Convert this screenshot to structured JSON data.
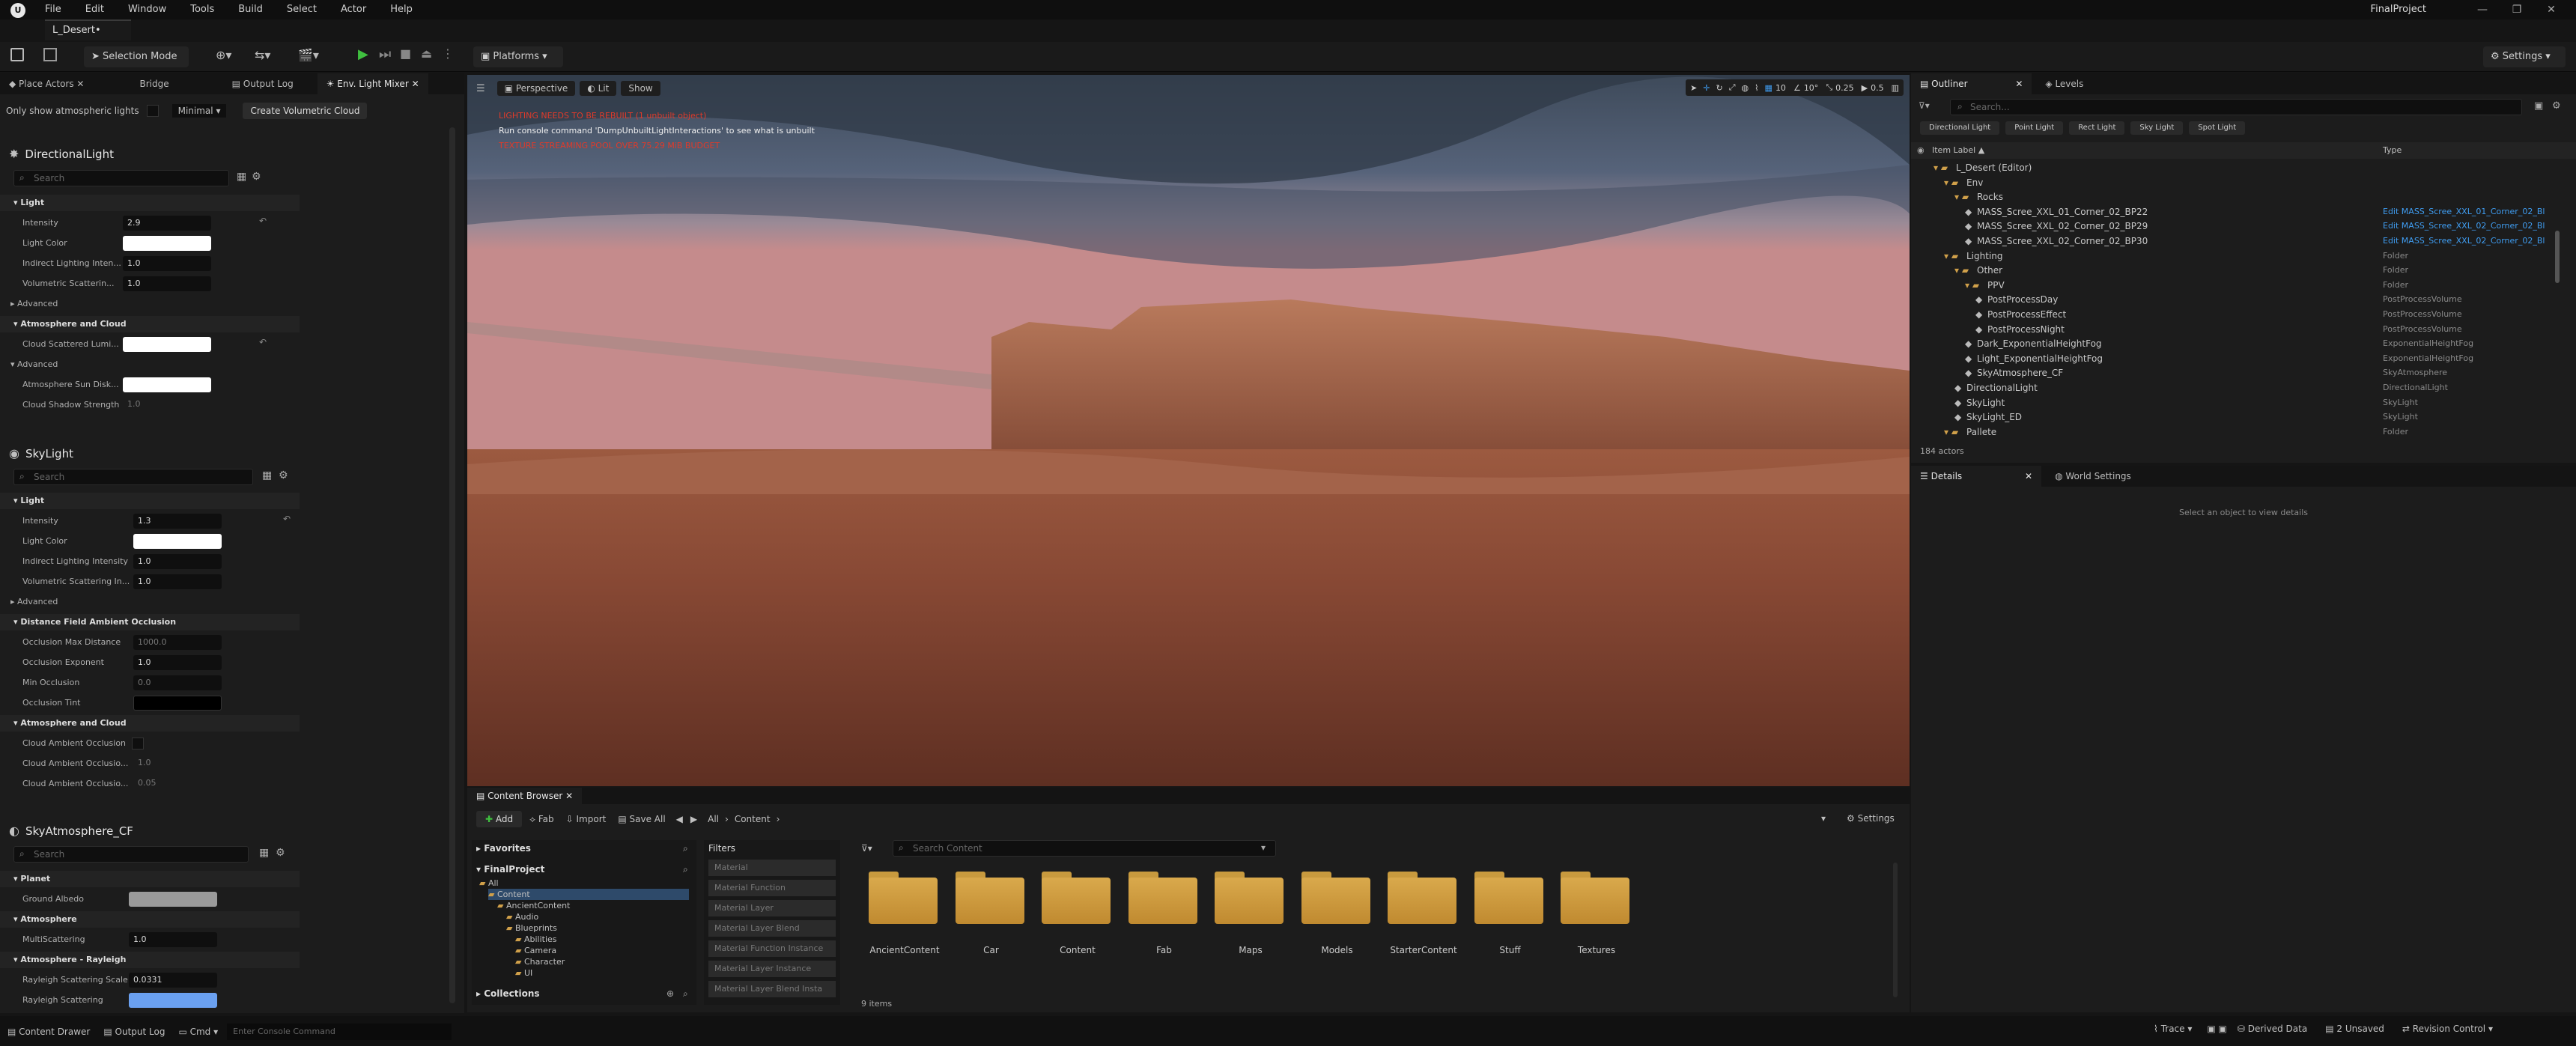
{
  "app": {
    "menu": [
      "File",
      "Edit",
      "Window",
      "Tools",
      "Build",
      "Select",
      "Actor",
      "Help"
    ],
    "map_tab": "L_Desert•",
    "project_name": "FinalProject"
  },
  "toolbar": {
    "selection_mode": "Selection Mode",
    "platforms": "Platforms",
    "settings": "Settings"
  },
  "left_tabs": [
    "Place Actors",
    "Bridge",
    "Output Log",
    "Env. Light Mixer"
  ],
  "light_mixer": {
    "only_atmospheric_label": "Only show atmospheric lights",
    "mode": "Minimal",
    "create_cloud_button": "Create Volumetric Cloud",
    "search_placeholder": "Search",
    "directional": {
      "title": "DirectionalLight",
      "sec_light": "Light",
      "intensity_label": "Intensity",
      "intensity": "2.9",
      "light_color_label": "Light Color",
      "indirect_label": "Indirect Lighting Inten...",
      "indirect": "1.0",
      "volumetric_label": "Volumetric Scatterin...",
      "volumetric": "1.0",
      "advanced": "Advanced",
      "sec_atmo": "Atmosphere and Cloud",
      "cloud_scattered_label": "Cloud Scattered Lumi...",
      "advanced2": "Advanced",
      "atmo_sun_label": "Atmosphere Sun Disk...",
      "cloud_shadow_label": "Cloud Shadow Strength",
      "cloud_shadow": "1.0"
    },
    "skylight": {
      "title": "SkyLight",
      "sec_light": "Light",
      "intensity_label": "Intensity",
      "intensity": "1.3",
      "light_color_label": "Light Color",
      "indirect_label": "Indirect Lighting Intensity",
      "indirect": "1.0",
      "volumetric_label": "Volumetric Scattering In...",
      "volumetric": "1.0",
      "advanced": "Advanced",
      "sec_dfao": "Distance Field Ambient Occlusion",
      "occ_max_label": "Occlusion Max Distance",
      "occ_max": "1000.0",
      "occ_exp_label": "Occlusion Exponent",
      "occ_exp": "1.0",
      "min_occ_label": "Min Occlusion",
      "min_occ": "0.0",
      "occ_tint_label": "Occlusion Tint",
      "sec_atmo": "Atmosphere and Cloud",
      "cloud_ao_label": "Cloud Ambient Occlusion",
      "cloud_ao2_label": "Cloud Ambient Occlusio...",
      "cloud_ao2": "1.0",
      "cloud_ao3_label": "Cloud Ambient Occlusio...",
      "cloud_ao3": "0.05"
    },
    "sky_atmo": {
      "title": "SkyAtmosphere_CF",
      "sec_planet": "Planet",
      "ground_albedo_label": "Ground Albedo",
      "sec_atmo": "Atmosphere",
      "multi_label": "MultiScattering",
      "multi": "1.0",
      "sec_rayleigh": "Atmosphere - Rayleigh",
      "ray_scale_label": "Rayleigh Scattering Scale",
      "ray_scale": "0.0331",
      "ray_scat_label": "Rayleigh Scattering"
    }
  },
  "viewport": {
    "perspective": "Perspective",
    "lit": "Lit",
    "show": "Show",
    "warn1": "LIGHTING NEEDS TO BE REBUILT (1 unbuilt object)",
    "warn2": "Run console command 'DumpUnbuiltLightInteractions' to see what is unbuilt",
    "warn3": "TEXTURE STREAMING POOL OVER 75.29 MiB BUDGET",
    "grid": "10",
    "rot": "10°",
    "scale": "0.25",
    "cam": "0.5"
  },
  "outliner": {
    "tab": "Outliner",
    "levels_tab": "Levels",
    "search_placeholder": "Search...",
    "filters": [
      "Directional Light",
      "Point Light",
      "Rect Light",
      "Sky Light",
      "Spot Light"
    ],
    "col_label": "Item Label ▲",
    "col_type": "Type",
    "rows": [
      {
        "label": "L_Desert (Editor)",
        "type": "",
        "indent": 0
      },
      {
        "label": "Env",
        "type": "",
        "indent": 1
      },
      {
        "label": "Rocks",
        "type": "",
        "indent": 2
      },
      {
        "label": "MASS_Scree_XXL_01_Corner_02_BP22",
        "type": "Edit MASS_Scree_XXL_01_Corner_02_Bl",
        "indent": 3,
        "link": true
      },
      {
        "label": "MASS_Scree_XXL_02_Corner_02_BP29",
        "type": "Edit MASS_Scree_XXL_02_Corner_02_Bl",
        "indent": 3,
        "link": true
      },
      {
        "label": "MASS_Scree_XXL_02_Corner_02_BP30",
        "type": "Edit MASS_Scree_XXL_02_Corner_02_Bl",
        "indent": 3,
        "link": true
      },
      {
        "label": "Lighting",
        "type": "Folder",
        "indent": 1
      },
      {
        "label": "Other",
        "type": "Folder",
        "indent": 2
      },
      {
        "label": "PPV",
        "type": "Folder",
        "indent": 3
      },
      {
        "label": "PostProcessDay",
        "type": "PostProcessVolume",
        "indent": 4
      },
      {
        "label": "PostProcessEffect",
        "type": "PostProcessVolume",
        "indent": 4
      },
      {
        "label": "PostProcessNight",
        "type": "PostProcessVolume",
        "indent": 4
      },
      {
        "label": "Dark_ExponentialHeightFog",
        "type": "ExponentialHeightFog",
        "indent": 3
      },
      {
        "label": "Light_ExponentialHeightFog",
        "type": "ExponentialHeightFog",
        "indent": 3
      },
      {
        "label": "SkyAtmosphere_CF",
        "type": "SkyAtmosphere",
        "indent": 3
      },
      {
        "label": "DirectionalLight",
        "type": "DirectionalLight",
        "indent": 2
      },
      {
        "label": "SkyLight",
        "type": "SkyLight",
        "indent": 2
      },
      {
        "label": "SkyLight_ED",
        "type": "SkyLight",
        "indent": 2
      },
      {
        "label": "Pallete",
        "type": "Folder",
        "indent": 1
      }
    ],
    "count": "184 actors"
  },
  "details": {
    "tab": "Details",
    "world_tab": "World Settings",
    "empty": "Select an object to view details"
  },
  "content_browser": {
    "tab": "Content Browser",
    "add": "Add",
    "fab": "Fab",
    "import": "Import",
    "save_all": "Save All",
    "path_all": "All",
    "path_content": "Content",
    "settings": "Settings",
    "favorites": "Favorites",
    "project": "FinalProject",
    "tree": [
      "All",
      "Content",
      "AncientContent",
      "Audio",
      "Blueprints",
      "Abilities",
      "Camera",
      "Character",
      "UI"
    ],
    "collections": "Collections",
    "filters_title": "Filters",
    "filters": [
      "Material",
      "Material Function",
      "Material Layer",
      "Material Layer Blend",
      "Material Function Instance",
      "Material Layer Instance",
      "Material Layer Blend Insta"
    ],
    "search_placeholder": "Search Content",
    "folders": [
      "AncientContent",
      "Car",
      "Content",
      "Fab",
      "Maps",
      "Models",
      "StarterContent",
      "Stuff",
      "Textures"
    ],
    "count": "9 items"
  },
  "status": {
    "content_drawer": "Content Drawer",
    "output_log": "Output Log",
    "cmd": "Cmd",
    "console_placeholder": "Enter Console Command",
    "trace": "Trace",
    "derived": "Derived Data",
    "unsaved": "2 Unsaved",
    "revision": "Revision Control"
  },
  "colors": {
    "accent": "#3f9cf0",
    "folder": "#d0a04a",
    "warn": "#e03a2a",
    "ray_scatter": "#6aa0f0"
  }
}
